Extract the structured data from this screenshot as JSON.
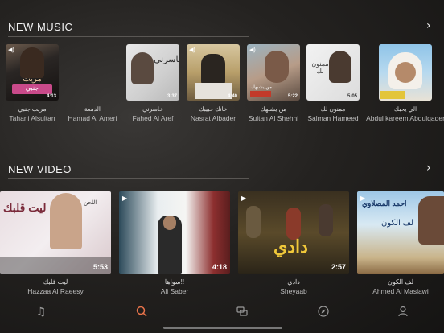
{
  "new_music": {
    "title": "NEW MUSIC",
    "items": [
      {
        "title": "مريت جنبي",
        "artist": "Tahani Alsultan",
        "duration": "4:13"
      },
      {
        "title": "الدمعة",
        "artist": "Hamad Al Ameri",
        "duration": ""
      },
      {
        "title": "خاسرني",
        "artist": "Fahed Al Aref",
        "duration": "3:37"
      },
      {
        "title": "خانك حبيبك",
        "artist": "Nasrat Albader",
        "duration": "4:40"
      },
      {
        "title": "من يشبهك",
        "artist": "Sultan Al Shehhi",
        "duration": "5:22"
      },
      {
        "title": "ممنون لك",
        "artist": "Salman Hameed",
        "duration": "5:05"
      },
      {
        "title": "الي يحبك",
        "artist": "Abdul kareem Abdulqader",
        "duration": ""
      }
    ]
  },
  "new_video": {
    "title": "NEW VIDEO",
    "items": [
      {
        "title": "ليت قلبك",
        "artist": "Hazzaa Al Raeesy",
        "duration": "5:53"
      },
      {
        "title": "سواها!!",
        "artist": "Ali Saber",
        "duration": "4:18"
      },
      {
        "title": "دادي",
        "artist": "Sheyaab",
        "duration": "2:57"
      },
      {
        "title": "لف الكون",
        "artist": "Ahmed Al Maslawi",
        "duration": ""
      }
    ]
  },
  "tabs": [
    "music-note-icon",
    "search-icon",
    "chat-icon",
    "compass-icon",
    "profile-icon"
  ],
  "colors": {
    "active_tab": "#e8734a",
    "inactive_tab": "#9a9a9a"
  }
}
